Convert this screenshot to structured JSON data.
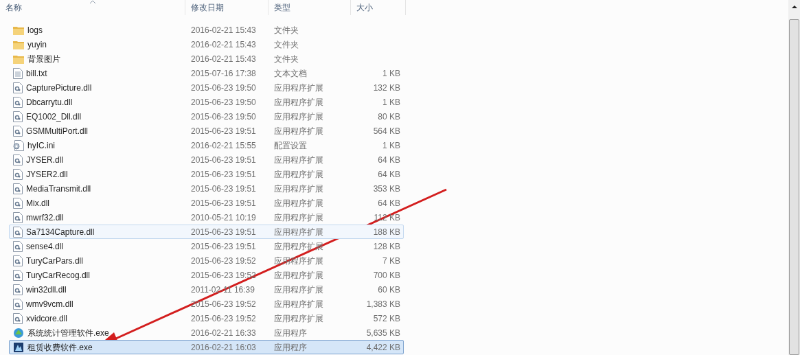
{
  "columns": [
    {
      "label": "名称",
      "sorted": true
    },
    {
      "label": "修改日期",
      "sorted": false
    },
    {
      "label": "类型",
      "sorted": false
    },
    {
      "label": "大小",
      "sorted": false
    }
  ],
  "rows": [
    {
      "kind": "folder",
      "name": "logs",
      "date": "2016-02-21 15:43",
      "type": "文件夹",
      "size": "",
      "hovered": false,
      "selected": false
    },
    {
      "kind": "folder",
      "name": "yuyin",
      "date": "2016-02-21 15:43",
      "type": "文件夹",
      "size": "",
      "hovered": false,
      "selected": false
    },
    {
      "kind": "folder",
      "name": "背景图片",
      "date": "2016-02-21 15:43",
      "type": "文件夹",
      "size": "",
      "hovered": false,
      "selected": false
    },
    {
      "kind": "text",
      "name": "bill.txt",
      "date": "2015-07-16 17:38",
      "type": "文本文档",
      "size": "1 KB",
      "hovered": false,
      "selected": false
    },
    {
      "kind": "dll",
      "name": "CapturePicture.dll",
      "date": "2015-06-23 19:50",
      "type": "应用程序扩展",
      "size": "132 KB",
      "hovered": false,
      "selected": false
    },
    {
      "kind": "dll",
      "name": "Dbcarrytu.dll",
      "date": "2015-06-23 19:50",
      "type": "应用程序扩展",
      "size": "1 KB",
      "hovered": false,
      "selected": false
    },
    {
      "kind": "dll",
      "name": "EQ1002_Dll.dll",
      "date": "2015-06-23 19:50",
      "type": "应用程序扩展",
      "size": "80 KB",
      "hovered": false,
      "selected": false
    },
    {
      "kind": "dll",
      "name": "GSMMultiPort.dll",
      "date": "2015-06-23 19:51",
      "type": "应用程序扩展",
      "size": "564 KB",
      "hovered": false,
      "selected": false
    },
    {
      "kind": "ini",
      "name": "hyIC.ini",
      "date": "2016-02-21 15:55",
      "type": "配置设置",
      "size": "1 KB",
      "hovered": false,
      "selected": false
    },
    {
      "kind": "dll",
      "name": "JYSER.dll",
      "date": "2015-06-23 19:51",
      "type": "应用程序扩展",
      "size": "64 KB",
      "hovered": false,
      "selected": false
    },
    {
      "kind": "dll",
      "name": "JYSER2.dll",
      "date": "2015-06-23 19:51",
      "type": "应用程序扩展",
      "size": "64 KB",
      "hovered": false,
      "selected": false
    },
    {
      "kind": "dll",
      "name": "MediaTransmit.dll",
      "date": "2015-06-23 19:51",
      "type": "应用程序扩展",
      "size": "353 KB",
      "hovered": false,
      "selected": false
    },
    {
      "kind": "dll",
      "name": "Mix.dll",
      "date": "2015-06-23 19:51",
      "type": "应用程序扩展",
      "size": "64 KB",
      "hovered": false,
      "selected": false
    },
    {
      "kind": "dll",
      "name": "mwrf32.dll",
      "date": "2010-05-21 10:19",
      "type": "应用程序扩展",
      "size": "112 KB",
      "hovered": false,
      "selected": false
    },
    {
      "kind": "dll",
      "name": "Sa7134Capture.dll",
      "date": "2015-06-23 19:51",
      "type": "应用程序扩展",
      "size": "188 KB",
      "hovered": true,
      "selected": false
    },
    {
      "kind": "dll",
      "name": "sense4.dll",
      "date": "2015-06-23 19:51",
      "type": "应用程序扩展",
      "size": "128 KB",
      "hovered": false,
      "selected": false
    },
    {
      "kind": "dll",
      "name": "TuryCarPars.dll",
      "date": "2015-06-23 19:52",
      "type": "应用程序扩展",
      "size": "7 KB",
      "hovered": false,
      "selected": false
    },
    {
      "kind": "dll",
      "name": "TuryCarRecog.dll",
      "date": "2015-06-23 19:52",
      "type": "应用程序扩展",
      "size": "700 KB",
      "hovered": false,
      "selected": false
    },
    {
      "kind": "dll",
      "name": "win32dll.dll",
      "date": "2011-02-11 16:39",
      "type": "应用程序扩展",
      "size": "60 KB",
      "hovered": false,
      "selected": false
    },
    {
      "kind": "dll",
      "name": "wmv9vcm.dll",
      "date": "2015-06-23 19:52",
      "type": "应用程序扩展",
      "size": "1,383 KB",
      "hovered": false,
      "selected": false
    },
    {
      "kind": "dll",
      "name": "xvidcore.dll",
      "date": "2015-06-23 19:52",
      "type": "应用程序扩展",
      "size": "572 KB",
      "hovered": false,
      "selected": false
    },
    {
      "kind": "exe",
      "name": "系统统计管理软件.exe",
      "date": "2016-02-21 16:33",
      "type": "应用程序",
      "size": "5,635 KB",
      "hovered": false,
      "selected": false
    },
    {
      "kind": "app",
      "name": "租赁收费软件.exe",
      "date": "2016-02-21 16:03",
      "type": "应用程序",
      "size": "4,422 KB",
      "hovered": false,
      "selected": true
    }
  ]
}
